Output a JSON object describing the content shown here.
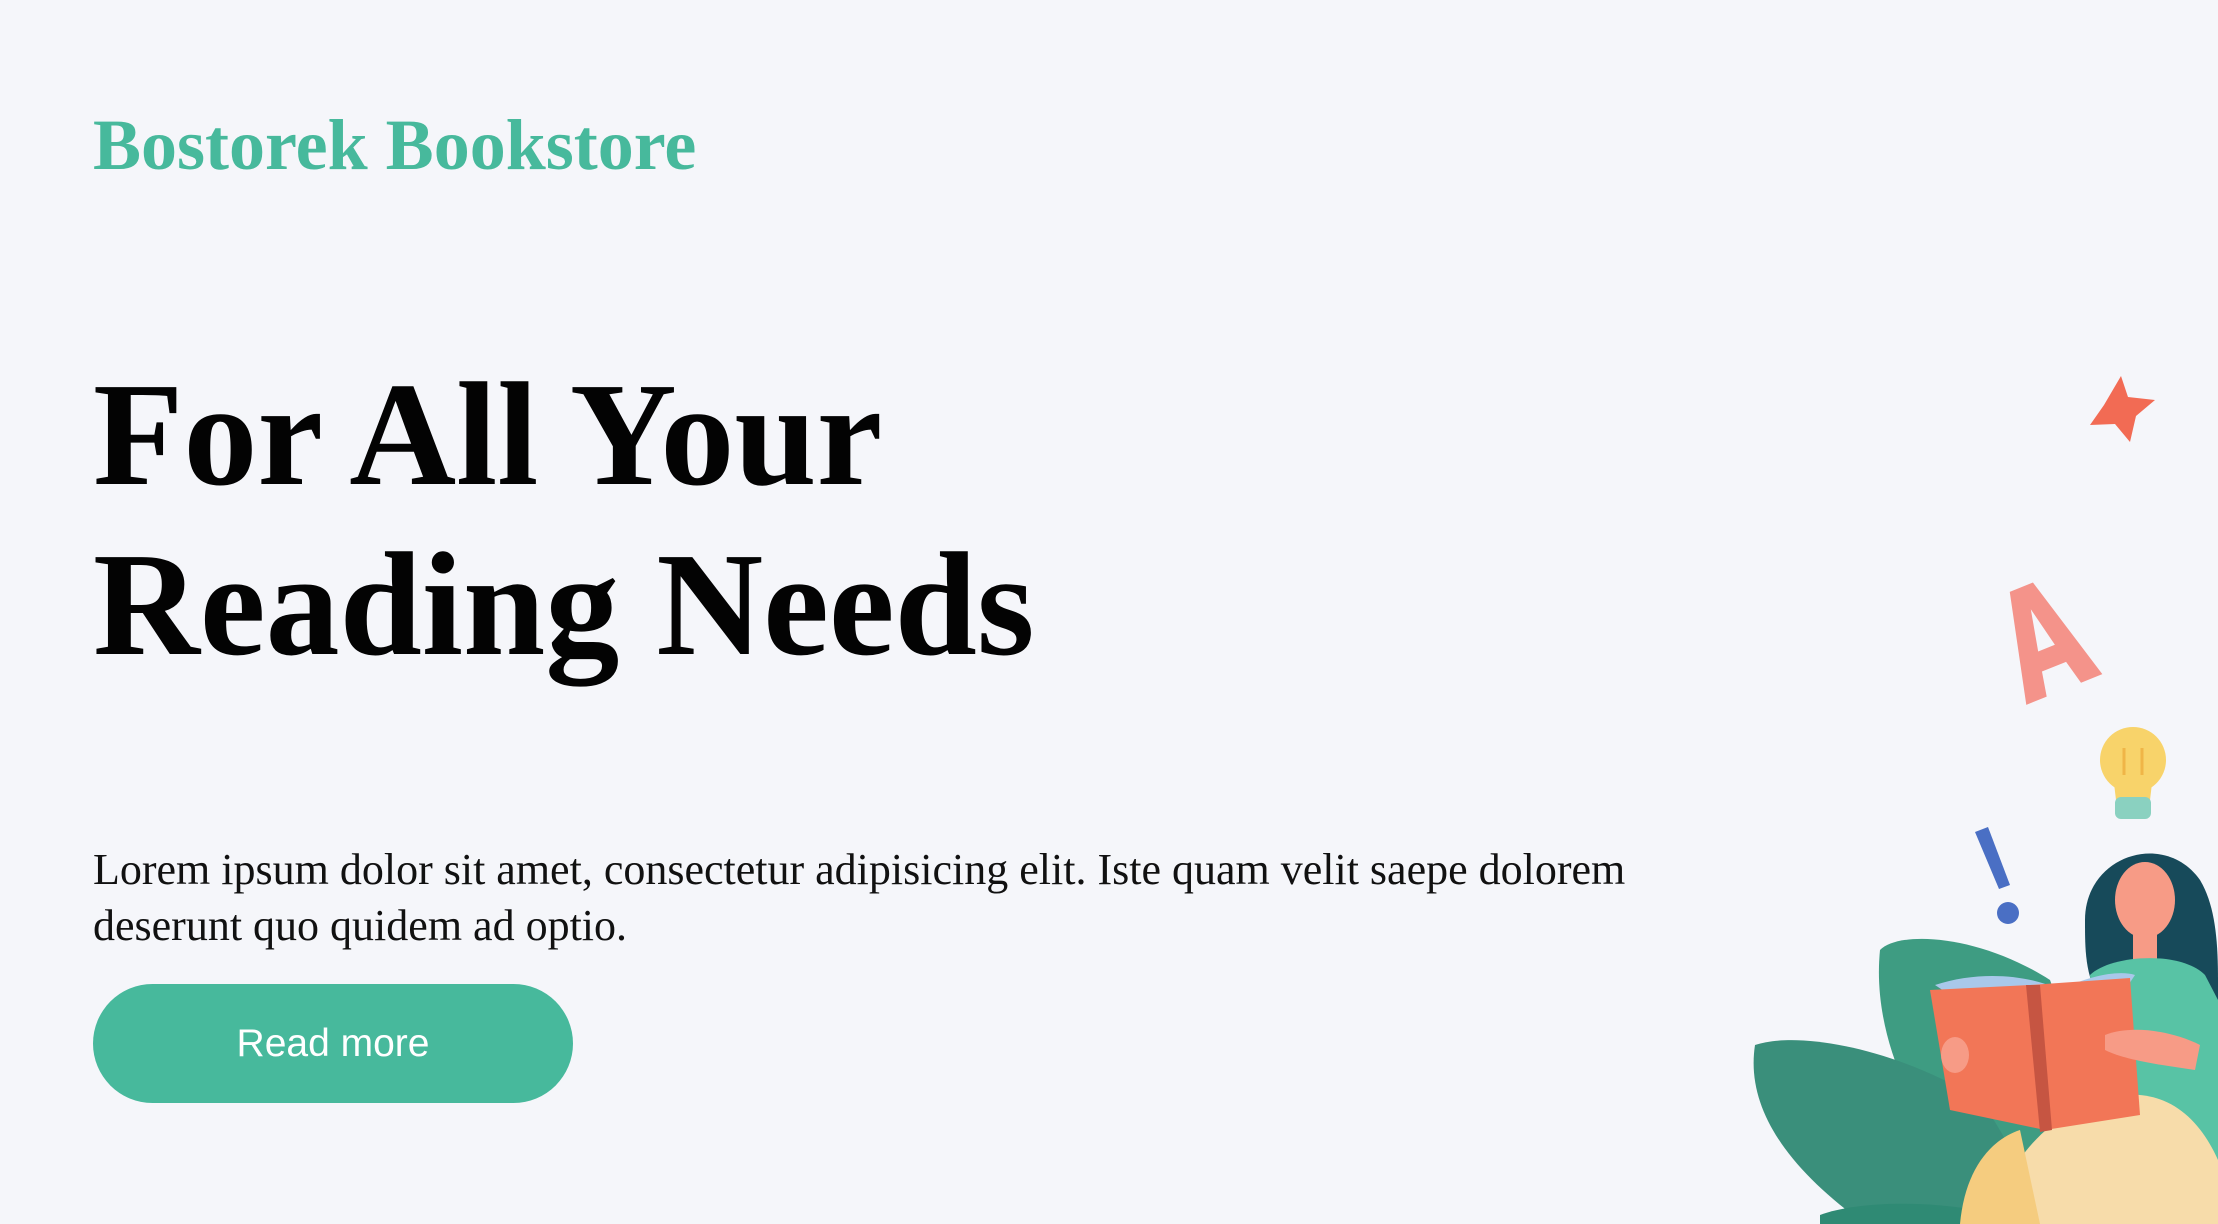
{
  "brand": {
    "name": "Bostorek Bookstore",
    "color": "#47b99c"
  },
  "hero": {
    "headline_line1": "For All Your",
    "headline_line2": "Reading Needs",
    "description": "Lorem ipsum dolor sit amet, consectetur adipisicing elit. Iste quam velit saepe dolorem deserunt quo quidem ad optio.",
    "cta_label": "Read more"
  },
  "illustration": {
    "icons": [
      "star-icon",
      "letter-a-icon",
      "lightbulb-icon",
      "exclamation-icon",
      "leaf-icon",
      "open-book-icon",
      "reading-woman"
    ],
    "colors": {
      "star": "#f26b54",
      "letter": "#f4938a",
      "bulb": "#f8d36a",
      "exclamation": "#4a6fc4",
      "leaf": "#3e9c82",
      "book": "#f27657",
      "hair": "#174a5a",
      "skin": "#f79b86",
      "shirt": "#58c3a5",
      "pants": "#f7dcaa"
    }
  }
}
